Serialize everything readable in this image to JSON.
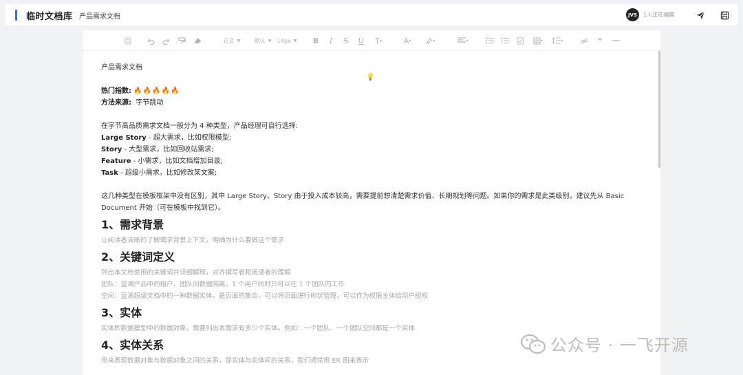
{
  "header": {
    "app_title": "临时文档库",
    "doc_title": "产品需求文档",
    "avatar_initials": "JVS",
    "presence_text": "1人正在编辑"
  },
  "toolbar": {
    "paragraph_style": "正文",
    "font_family": "默认",
    "font_size": "14px"
  },
  "document": {
    "title_line": "产品需求文档",
    "hot_label": "热门指数:",
    "hot_icons": "🔥🔥🔥🔥🔥",
    "source_label": "方法来源:",
    "source_value": "字节跳动",
    "intro": "在字节高品质需求文档一般分为 4 种类型，产品经理可自行选择:",
    "types": [
      {
        "name": "Large Story",
        "desc": " - 超大需求，比如权限模型;"
      },
      {
        "name": "Story",
        "desc": " - 大型需求，比如回收站需求;"
      },
      {
        "name": "Feature",
        "desc": " - 小需求，比如文档增加目录;"
      },
      {
        "name": "Task",
        "desc": " - 超级小需求，比如修改某文案;"
      }
    ],
    "note": "这几种类型在模板框架中没有区别，其中 Large Story、Story 由于投入成本较高，需要提前想清楚需求价值、长期规划等问题。如果你的需求是此类级别，建议先从 Basic Document 开始（可在模板中找到它）。",
    "sections": [
      {
        "heading": "1、需求背景",
        "lines": [
          "让阅读者清晰的了解需求背景上下文，明确为什么要做这个需求"
        ]
      },
      {
        "heading": "2、关键词定义",
        "lines": [
          "列出本文档使用的关键词并详细解释，对齐撰写者和阅读者的理解",
          "团队：蓝湖产品中的租户，团队间数据隔离，1 个用户同时只可以在 1 个团队内工作",
          "空间：蓝湖超级文档中的一种数据实体，是页面的集合，可以将页面进行树状管理，可以作为权限主体给用户授权"
        ]
      },
      {
        "heading": "3、实体",
        "lines": [
          "实体即数据模型中的数据对象，需要列出本需求有多少个实体。例如：一个团队、一个团队空间都是一个实体"
        ]
      },
      {
        "heading": "4、实体关系",
        "lines": [
          "用来表现数据对象与数据对象之间的关系，即实体与实体间的关系，我们通常用 ER 图来表示"
        ]
      }
    ]
  },
  "watermark": {
    "text": "公众号 · 一飞开源"
  }
}
